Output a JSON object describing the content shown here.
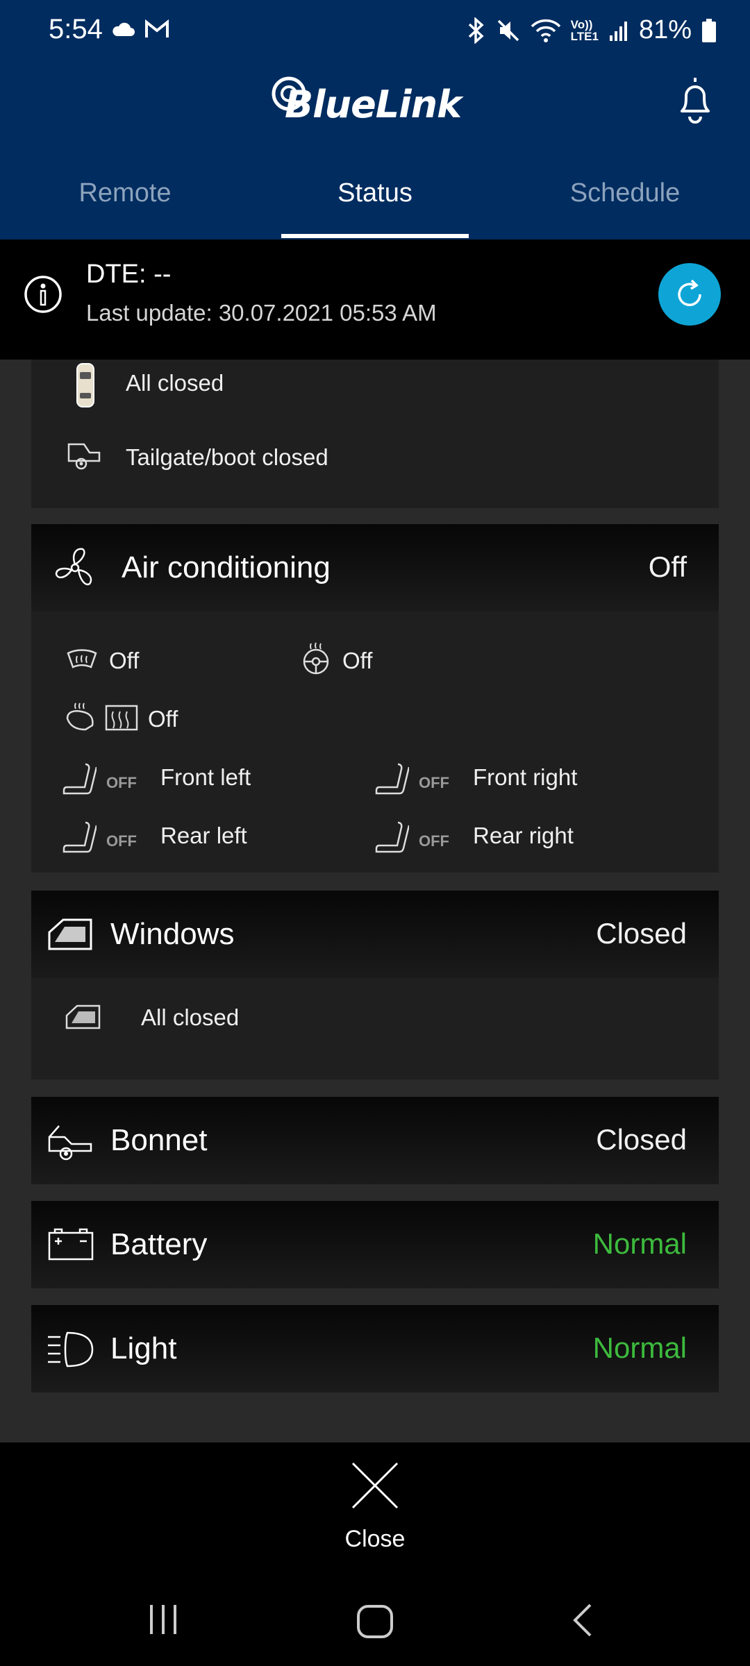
{
  "status_bar": {
    "time": "5:54",
    "battery": "81%",
    "lte_label": "LTE1",
    "volte_label": "Vo))",
    "icons_left": [
      "cloud-icon",
      "gmail-icon"
    ],
    "icons_right": [
      "bluetooth-icon",
      "mute-icon",
      "wifi-icon",
      "signal-icon",
      "battery-icon"
    ]
  },
  "header": {
    "logo_text": "BlueLink",
    "tabs": [
      {
        "label": "Remote",
        "active": false
      },
      {
        "label": "Status",
        "active": true
      },
      {
        "label": "Schedule",
        "active": false
      }
    ]
  },
  "info": {
    "dte": "DTE: --",
    "last_update": "Last update: 30.07.2021 05:53 AM"
  },
  "doors": {
    "all_closed": "All closed",
    "tailgate": "Tailgate/boot closed"
  },
  "air_conditioning": {
    "title": "Air conditioning",
    "status": "Off",
    "front_defrost": "Off",
    "steering_heat": "Off",
    "mirror_rear_heat": "Off",
    "seats": [
      {
        "badge": "OFF",
        "label": "Front left"
      },
      {
        "badge": "OFF",
        "label": "Front right"
      },
      {
        "badge": "OFF",
        "label": "Rear left"
      },
      {
        "badge": "OFF",
        "label": "Rear right"
      }
    ]
  },
  "windows": {
    "title": "Windows",
    "status": "Closed",
    "detail": "All closed"
  },
  "bonnet": {
    "title": "Bonnet",
    "status": "Closed"
  },
  "battery": {
    "title": "Battery",
    "status": "Normal"
  },
  "light": {
    "title": "Light",
    "status": "Normal"
  },
  "footer": {
    "close_label": "Close"
  },
  "colors": {
    "header_bg": "#002c5f",
    "accent_refresh": "#0ea5d6",
    "normal_green": "#3dbb3d"
  }
}
